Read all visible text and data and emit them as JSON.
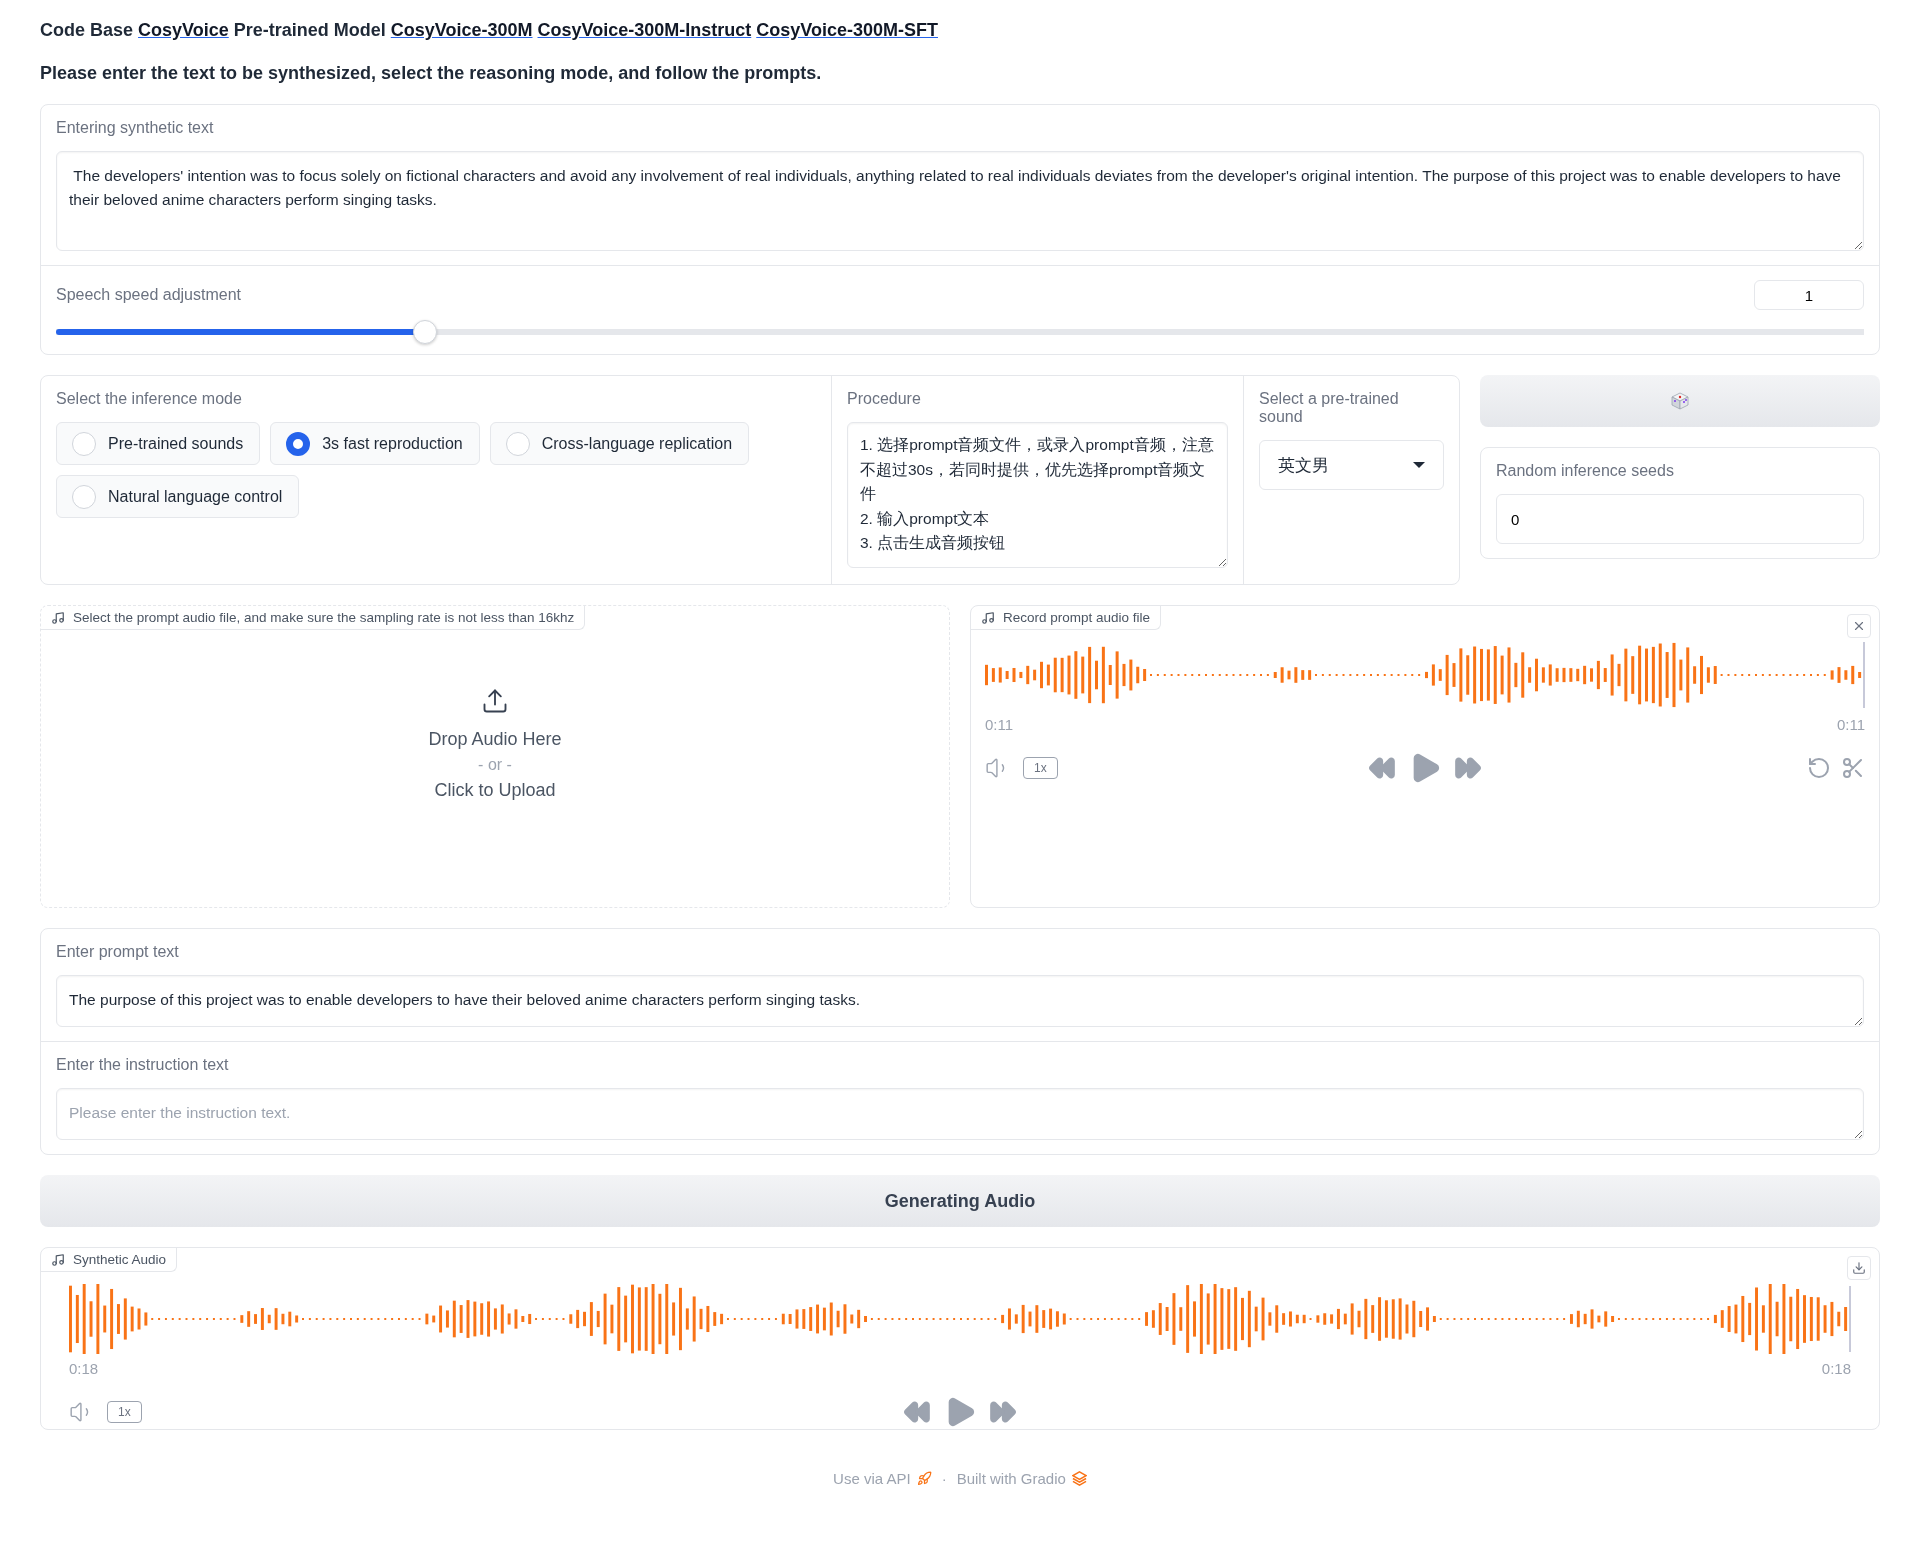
{
  "header": {
    "parts": [
      {
        "kind": "text",
        "text": "Code Base"
      },
      {
        "kind": "link",
        "text": "CosyVoice"
      },
      {
        "kind": "text",
        "text": "Pre-trained Model"
      },
      {
        "kind": "link",
        "text": "CosyVoice-300M"
      },
      {
        "kind": "link",
        "text": "CosyVoice-300M-Instruct"
      },
      {
        "kind": "link",
        "text": "CosyVoice-300M-SFT"
      }
    ]
  },
  "instructions": "Please enter the text to be synthesized, select the reasoning mode, and follow the prompts.",
  "synthetic_text": {
    "label": "Entering synthetic text",
    "value": " The developers' intention was to focus solely on fictional characters and avoid any involvement of real individuals, anything related to real individuals deviates from the developer's original intention. The purpose of this project was to enable developers to have their beloved anime characters perform singing tasks."
  },
  "speed": {
    "label": "Speech speed adjustment",
    "value": "1",
    "level": 0.204
  },
  "inference_mode": {
    "label": "Select the inference mode",
    "options": [
      {
        "label": "Pre-trained sounds",
        "selected": false
      },
      {
        "label": "3s fast reproduction",
        "selected": true
      },
      {
        "label": "Cross-language replication",
        "selected": false
      },
      {
        "label": "Natural language control",
        "selected": false
      }
    ]
  },
  "procedure": {
    "label": "Procedure",
    "value": "1. 选择prompt音频文件，或录入prompt音频，注意不超过30s，若同时提供，优先选择prompt音频文件\n2. 输入prompt文本\n3. 点击生成音频按钮"
  },
  "pretrained_sound": {
    "label": "Select a pre-trained sound",
    "value": "英文男"
  },
  "seed": {
    "label": "Random inference seeds",
    "value": "0"
  },
  "prompt_upload": {
    "label": "Select the prompt audio file, and make sure the sampling rate is not less than 16khz",
    "drop_text": "Drop Audio Here",
    "or_text": "- or -",
    "click_text": "Click to Upload"
  },
  "prompt_record": {
    "label": "Record prompt audio file",
    "current_time": "0:11",
    "duration": "0:11",
    "speed": "1x"
  },
  "prompt_text": {
    "label": "Enter prompt text",
    "value": "The purpose of this project was to enable developers to have their beloved anime characters perform singing tasks."
  },
  "instruction_text": {
    "label": "Enter the instruction text",
    "placeholder": "Please enter the instruction text."
  },
  "generate_button": "Generating Audio",
  "output_audio": {
    "label": "Synthetic Audio",
    "current_time": "0:18",
    "duration": "0:18",
    "speed": "1x"
  },
  "footer": {
    "api_link": "Use via API",
    "separator": "·",
    "built_with": "Built with Gradio"
  }
}
